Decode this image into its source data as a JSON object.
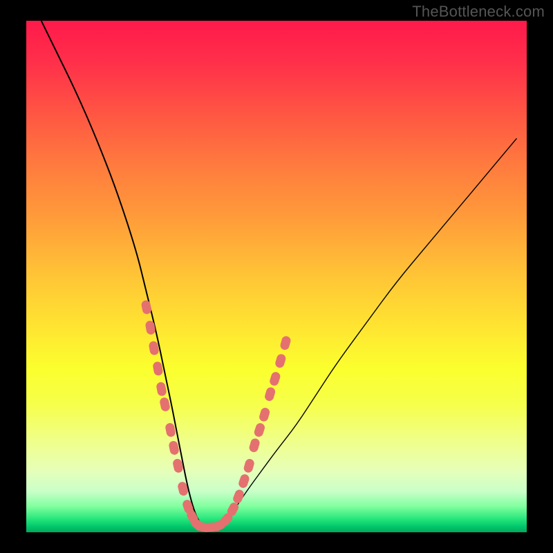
{
  "watermark": "TheBottleneck.com",
  "colors": {
    "background": "#000000",
    "curve": "#000000",
    "marker": "#e4716f"
  },
  "chart_data": {
    "type": "line",
    "title": "",
    "xlabel": "",
    "ylabel": "",
    "xlim": [
      0,
      100
    ],
    "ylim": [
      0,
      100
    ],
    "series": [
      {
        "name": "bottleneck-curve",
        "x": [
          3,
          6,
          10,
          14,
          18,
          22,
          24,
          26,
          27.5,
          29,
          30,
          31,
          32,
          33,
          34,
          35,
          36,
          38,
          40,
          42,
          44,
          47,
          50,
          54,
          58,
          62,
          68,
          74,
          80,
          86,
          92,
          98
        ],
        "y": [
          100,
          94,
          86,
          77,
          67,
          55,
          47,
          39,
          32,
          25,
          20,
          15,
          10,
          6,
          3,
          1.5,
          1,
          1.2,
          2.5,
          5,
          8,
          12,
          16,
          21,
          27,
          33,
          41,
          49,
          56,
          63,
          70,
          77
        ]
      }
    ],
    "markers": {
      "name": "sample-points",
      "points": [
        {
          "x": 24.0,
          "y": 44
        },
        {
          "x": 24.8,
          "y": 40
        },
        {
          "x": 25.5,
          "y": 36
        },
        {
          "x": 26.3,
          "y": 32
        },
        {
          "x": 27.0,
          "y": 28
        },
        {
          "x": 27.7,
          "y": 25
        },
        {
          "x": 28.8,
          "y": 20
        },
        {
          "x": 29.5,
          "y": 16.5
        },
        {
          "x": 30.3,
          "y": 13
        },
        {
          "x": 31.3,
          "y": 8.5
        },
        {
          "x": 32.3,
          "y": 5
        },
        {
          "x": 33.2,
          "y": 3
        },
        {
          "x": 34.2,
          "y": 1.5
        },
        {
          "x": 35.5,
          "y": 1
        },
        {
          "x": 37.0,
          "y": 1
        },
        {
          "x": 38.5,
          "y": 1.3
        },
        {
          "x": 40.0,
          "y": 2.5
        },
        {
          "x": 41.3,
          "y": 4.5
        },
        {
          "x": 42.4,
          "y": 7
        },
        {
          "x": 43.5,
          "y": 10
        },
        {
          "x": 44.5,
          "y": 13
        },
        {
          "x": 45.6,
          "y": 17
        },
        {
          "x": 46.6,
          "y": 20
        },
        {
          "x": 47.6,
          "y": 23
        },
        {
          "x": 48.7,
          "y": 27
        },
        {
          "x": 49.7,
          "y": 30
        },
        {
          "x": 50.8,
          "y": 33.5
        },
        {
          "x": 51.8,
          "y": 37
        }
      ]
    }
  }
}
